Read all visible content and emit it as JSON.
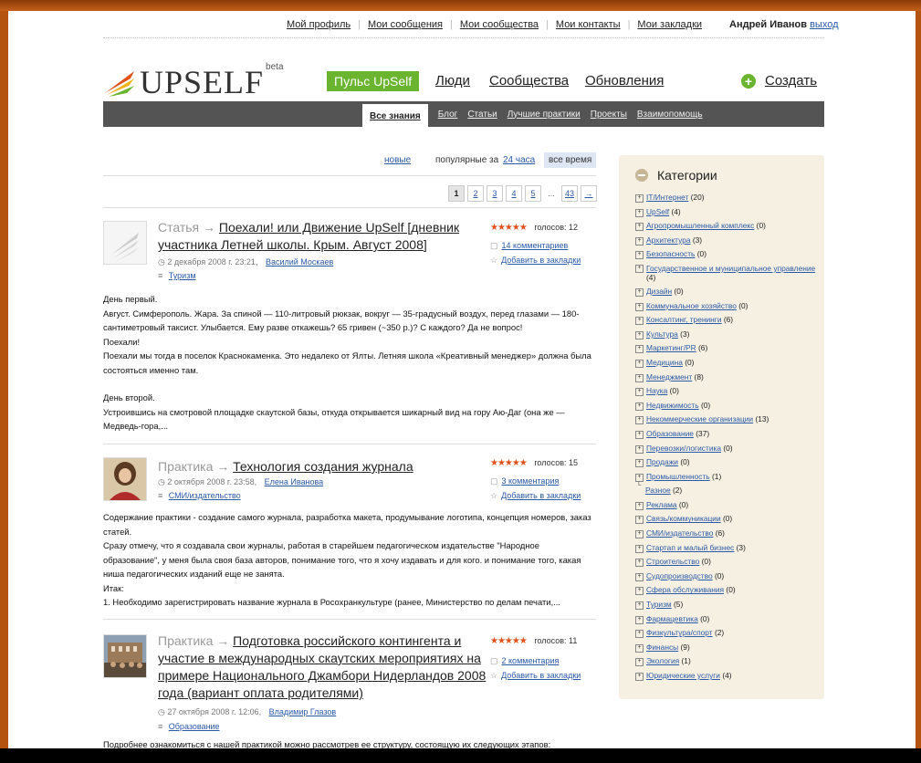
{
  "top_nav": {
    "links": [
      "Мой профиль",
      "Мои сообщения",
      "Мои сообщества",
      "Мои контакты",
      "Мои закладки"
    ],
    "user_name": "Андрей Иванов",
    "logout": "выход"
  },
  "logo": {
    "text": "UPSELF",
    "beta": "beta"
  },
  "main_nav": {
    "puls": "Пульс UpSelf",
    "people": "Люди",
    "communities": "Сообщества",
    "updates": "Обновления",
    "create": "Создать"
  },
  "sub_nav": [
    "Все знания",
    "Блог",
    "Статьи",
    "Лучшие практики",
    "Проекты",
    "Взаимопомощь"
  ],
  "filters": {
    "new": "новые",
    "popular_label": "популярные за",
    "day": "24 часа",
    "all_time": "все время"
  },
  "pagination": [
    "1",
    "2",
    "3",
    "4",
    "5",
    "...",
    "43",
    "→"
  ],
  "posts": [
    {
      "type": "Статья →",
      "title": "Поехали! или Движение UpSelf [дневник участника Летней школы. Крым. Август 2008]",
      "date": "2 декабря 2008 г. 23:21,",
      "author": "Василий Москаев",
      "category": "Туризм",
      "stars": "★★★★★",
      "votes": "голосов: 12",
      "comments": "14 комментариев",
      "bookmark": "Добавить в закладки",
      "body": [
        "День первый.",
        "Август. Симферополь. Жара. За спиной — 110-литровый рюкзак, вокруг — 35-градусный воздух, перед глазами — 180-сантиметровый таксист. Улыбается. Ему разве откажешь? 65 гривен (~350 р.)? С каждого? Да не вопрос!",
        "Поехали!",
        "Поехали мы тогда в поселок Краснокаменка. Это недалеко от Ялты. Летняя школа «Креативный менеджер» должна была состояться именно там.",
        "",
        "День второй.",
        "Устроившись на смотровой площадке скаутской базы, откуда открывается шикарный вид на гору Аю-Даг (она же — Медведь-гора,..."
      ]
    },
    {
      "type": "Практика →",
      "title": "Технология создания журнала",
      "date": "2 октября 2008 г. 23:58,",
      "author": "Елена Иванова",
      "category": "СМИ/издательство",
      "stars": "★★★★★",
      "votes": "голосов: 15",
      "comments": "3 комментария",
      "bookmark": "Добавить в закладки",
      "body": [
        "Содержание практики - создание самого журнала, разработка макета, продумывание логотипа, концепция номеров, заказ статей.",
        "Сразу отмечу, что я создавала свои журналы, работая в старейшем педагогическом издательстве \"Народное образование\", у меня была своя база авторов, понимание того, что я хочу издавать и для кого. и понимание того, какая ниша педагогических изданий еще не занята.",
        "Итак:",
        "1. Необходимо зарегистрировать название журнала в Росохранкультуре (ранее, Министерство по делам печати,..."
      ]
    },
    {
      "type": "Практика →",
      "title": "Подготовка российского контингента и участие в международных скаутских мероприятиях на примере Национального Джамбори Нидерландов 2008 года (вариант оплата родителями)",
      "date": "27 октября 2008 г. 12:06,",
      "author": "Владимир Глазов",
      "category": "Образование",
      "stars": "★★★★★",
      "votes": "голосов: 11",
      "comments": "2 комментария",
      "bookmark": "Добавить в закладки",
      "body": [
        "Подробнее ознакомиться с нашей практикой можно рассмотрев ее структуру, состоящую их следующих этапов:"
      ]
    }
  ],
  "sidebar": {
    "title": "Категории",
    "categories": [
      {
        "name": "IT/Интернет",
        "count": "(20)"
      },
      {
        "name": "UpSelf",
        "count": "(4)"
      },
      {
        "name": "Агропромышленный комплекс",
        "count": "(0)"
      },
      {
        "name": "Архитектура",
        "count": "(3)"
      },
      {
        "name": "Безопасность",
        "count": "(0)"
      },
      {
        "name": "Государственное и муниципальное управление",
        "count": "(4)"
      },
      {
        "name": "Дизайн",
        "count": "(0)"
      },
      {
        "name": "Коммунальное хозяйство",
        "count": "(0)"
      },
      {
        "name": "Консалтинг, тренинги",
        "count": "(6)"
      },
      {
        "name": "Культура",
        "count": "(3)"
      },
      {
        "name": "Маркетинг/PR",
        "count": "(6)"
      },
      {
        "name": "Медицина",
        "count": "(0)"
      },
      {
        "name": "Менеджмент",
        "count": "(8)"
      },
      {
        "name": "Наука",
        "count": "(0)"
      },
      {
        "name": "Недвижимость",
        "count": "(0)"
      },
      {
        "name": "Некоммерческие организации",
        "count": "(13)"
      },
      {
        "name": "Образование",
        "count": "(37)"
      },
      {
        "name": "Перевозки/логистика",
        "count": "(0)"
      },
      {
        "name": "Продажи",
        "count": "(0)"
      },
      {
        "name": "Промышленность",
        "count": "(1)"
      },
      {
        "name": "Разное",
        "count": "(2)"
      },
      {
        "name": "Реклама",
        "count": "(0)"
      },
      {
        "name": "Связь/коммуникации",
        "count": "(0)"
      },
      {
        "name": "СМИ/издательство",
        "count": "(6)"
      },
      {
        "name": "Стартап и малый бизнес",
        "count": "(3)"
      },
      {
        "name": "Строительство",
        "count": "(0)"
      },
      {
        "name": "Судопроизводство",
        "count": "(0)"
      },
      {
        "name": "Сфера обслуживания",
        "count": "(0)"
      },
      {
        "name": "Туризм",
        "count": "(5)"
      },
      {
        "name": "Фармацевтика",
        "count": "(0)"
      },
      {
        "name": "Физкультура/спорт",
        "count": "(2)"
      },
      {
        "name": "Финансы",
        "count": "(9)"
      },
      {
        "name": "Экология",
        "count": "(1)"
      },
      {
        "name": "Юридические услуги",
        "count": "(4)"
      }
    ]
  },
  "colors": {
    "accent_green": "#6ab42f",
    "link_blue": "#2a5aa8",
    "subnav_bg": "#545454",
    "sidebar_bg": "#f6f0e2",
    "frame": "#b4520f",
    "stars": "#e0501a"
  }
}
